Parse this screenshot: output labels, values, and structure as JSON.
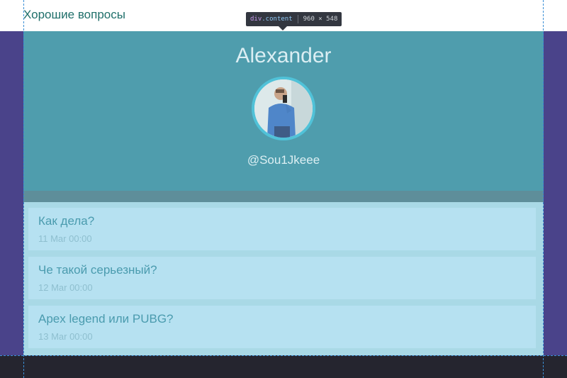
{
  "site": {
    "title": "Хорошие вопросы"
  },
  "profile": {
    "name": "Alexander",
    "handle": "@Sou1Jkeee"
  },
  "questions": [
    {
      "text": "Как дела?",
      "date": "11 Mar 00:00"
    },
    {
      "text": "Че такой серьезный?",
      "date": "12 Mar 00:00"
    },
    {
      "text": "Apex legend или PUBG?",
      "date": "13 Mar 00:00"
    }
  ],
  "devtools": {
    "tag": "div",
    "class": ".content",
    "size": "960 × 548"
  },
  "colors": {
    "outer_background": "#4a438a",
    "profile_background": "#4f9dad",
    "card_background": "#b6e1f1",
    "footer": "#25252f"
  }
}
